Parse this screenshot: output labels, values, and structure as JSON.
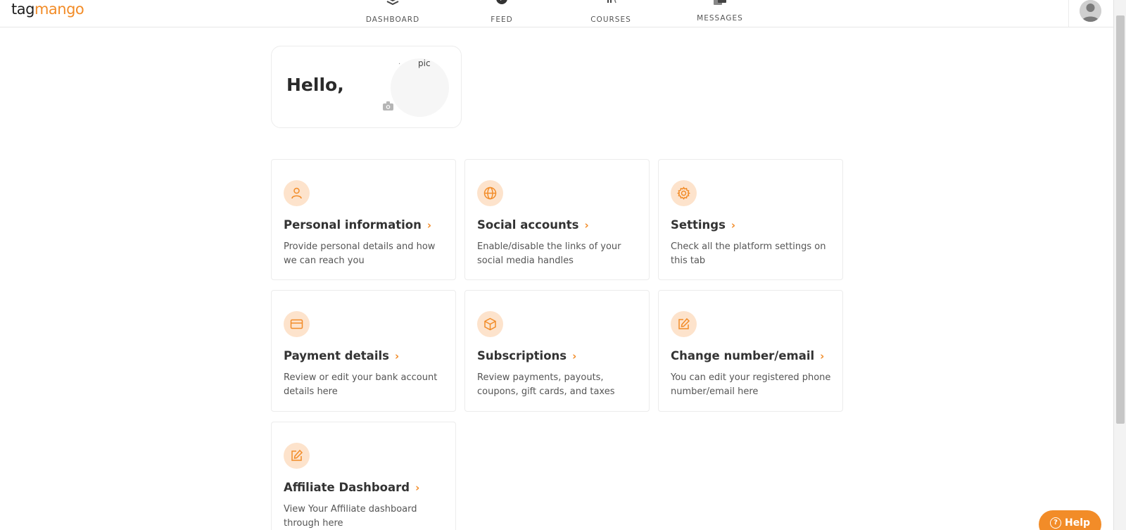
{
  "header": {
    "logo_part1": "tag",
    "logo_part2": "mango",
    "nav": [
      {
        "label": "DASHBOARD",
        "icon": "dashboard-layers-icon"
      },
      {
        "label": "FEED",
        "icon": "feed-icon"
      },
      {
        "label": "COURSES",
        "icon": "courses-books-icon"
      },
      {
        "label": "MESSAGES",
        "icon": "messages-icon"
      }
    ],
    "avatar_icon": "user-avatar-icon"
  },
  "hello_card": {
    "greeting": "Hello,",
    "pic_alt_dot": ".",
    "pic_alt": "pic",
    "camera_icon": "camera-icon"
  },
  "tiles": [
    {
      "title": "Personal information",
      "desc": "Provide personal details and how we can reach you",
      "icon": "user-icon"
    },
    {
      "title": "Social accounts",
      "desc": "Enable/disable the links of your social media handles",
      "icon": "globe-icon"
    },
    {
      "title": "Settings",
      "desc": "Check all the platform settings on this tab",
      "icon": "gear-icon"
    },
    {
      "title": "Payment details",
      "desc": "Review or edit your bank account details here",
      "icon": "credit-card-icon"
    },
    {
      "title": "Subscriptions",
      "desc": "Review payments, payouts, coupons, gift cards, and taxes",
      "icon": "package-icon"
    },
    {
      "title": "Change number/email",
      "desc": "You can edit your registered phone number/email here",
      "icon": "edit-icon"
    },
    {
      "title": "Affiliate Dashboard",
      "desc": "View Your Affiliate dashboard through here",
      "icon": "edit-icon"
    }
  ],
  "chevron": "›",
  "help": {
    "label": "Help",
    "icon_glyph": "?"
  },
  "colors": {
    "accent": "#f28c28",
    "icon_bg": "#fde3cc"
  }
}
